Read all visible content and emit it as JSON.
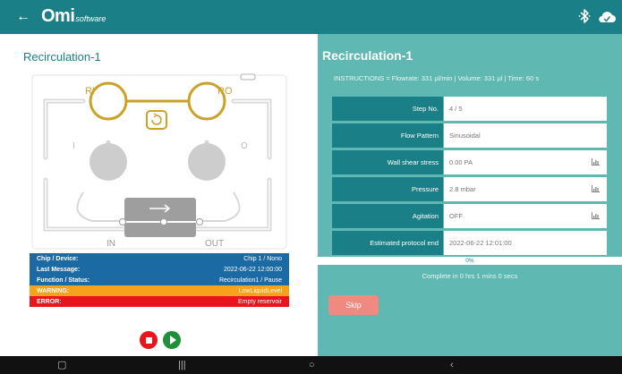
{
  "topbar": {
    "back_icon": "arrow-left-icon",
    "logo_mark": "Omi",
    "logo_sub": "software",
    "icons": [
      "bluetooth-icon",
      "cloud-icon"
    ]
  },
  "left": {
    "title": "Recirculation-1",
    "chip_labels": {
      "ri": "RI",
      "ro": "RO",
      "i": "I",
      "o": "O",
      "in": "IN",
      "out": "OUT"
    },
    "info_rows": [
      {
        "key": "Chip / Device:",
        "value": "Chip 1 / Nono",
        "style": "blue"
      },
      {
        "key": "Last Message:",
        "value": "2022-06-22 12:00:00",
        "style": "blue"
      },
      {
        "key": "Function / Status:",
        "value": "Recirculation1 / Pause",
        "style": "blue"
      },
      {
        "key": "WARNING:",
        "value": "LowLiquidLevel",
        "style": "warn"
      },
      {
        "key": "ERROR:",
        "value": "Empty reservoir",
        "style": "err"
      }
    ],
    "controls": {
      "stop_icon": "stop-icon",
      "play_icon": "play-icon"
    }
  },
  "right": {
    "title": "Recirculation-1",
    "instructions": "INSTRUCTIONS = Flowrate: 331 µl/min | Volume: 331 µl | Time: 60 s",
    "rows": [
      {
        "label": "Step No.",
        "value": "4 / 5",
        "chart": false
      },
      {
        "label": "Flow Pattern",
        "value": "Sinusoidal",
        "chart": false
      },
      {
        "label": "Wall shear stress",
        "value": "0.00 PA",
        "chart": true
      },
      {
        "label": "Pressure",
        "value": "2.8 mbar",
        "chart": true
      },
      {
        "label": "Agitation",
        "value": "OFF",
        "chart": true
      },
      {
        "label": "Estimated protocol end",
        "value": "2022-06-22 12:01:00",
        "chart": false
      }
    ],
    "progress": {
      "label": "0%",
      "fraction": 0.0
    },
    "complete_text": "Complete in 0 hrs 1 mins 0 secs",
    "skip_label": "Skip"
  },
  "colors": {
    "topbar": "#1a7f86",
    "right_panel": "#5fb8b2",
    "info_blue": "#1c6aa3",
    "warning": "#f7a21b",
    "error": "#e8161c",
    "chip_gold": "#c9a227",
    "skip_button": "#ef8a82"
  }
}
